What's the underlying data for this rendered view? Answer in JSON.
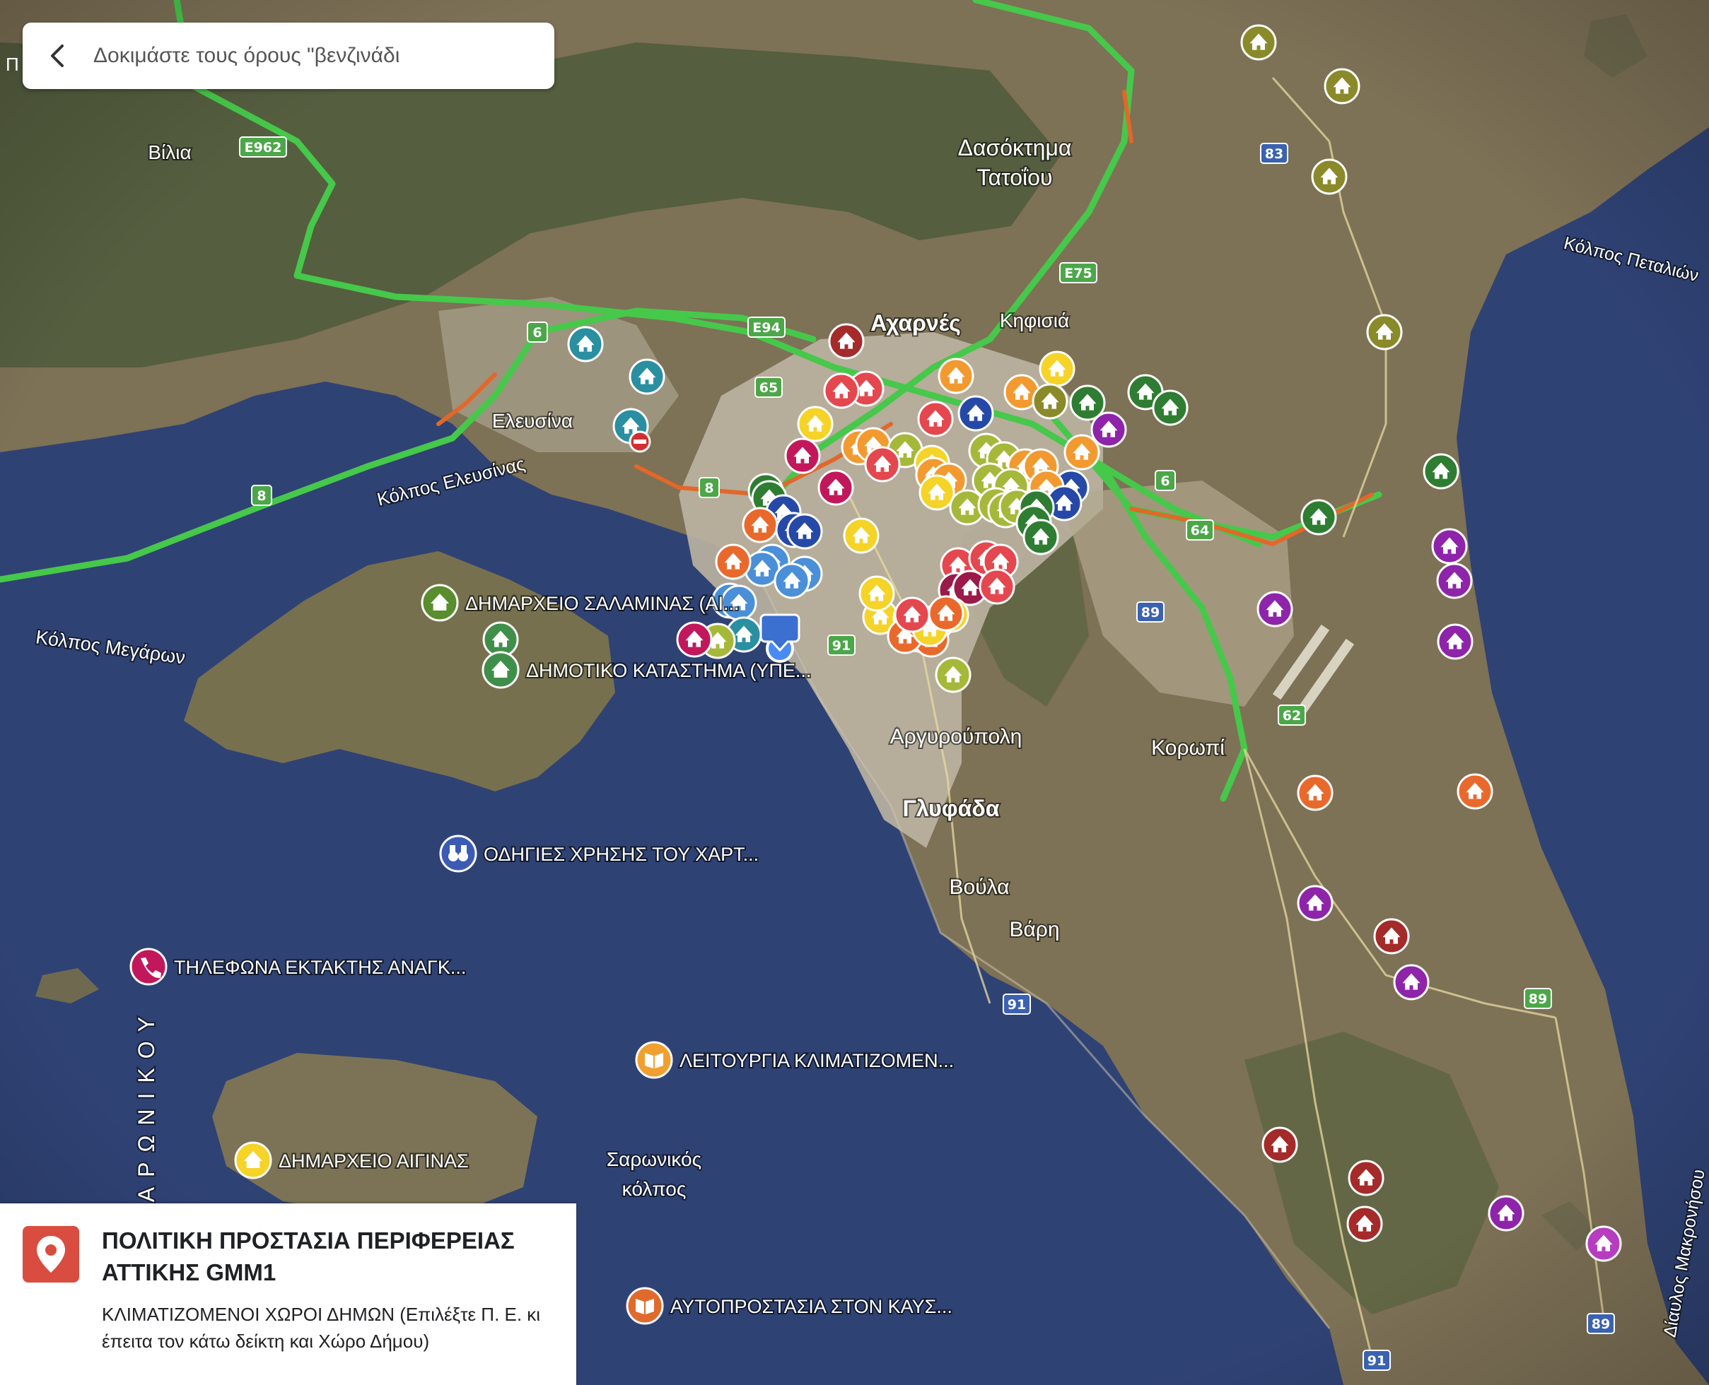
{
  "search": {
    "placeholder": "Δοκιμάστε τους όρους \"βενζινάδι",
    "edge_glyph": "Π"
  },
  "info_card": {
    "title": "ΠΟΛΙΤΙΚΗ ΠΡΟΣΤΑΣΙΑ ΠΕΡΙΦΕΡΕΙΑΣ ΑΤΤΙΚΗΣ GMM1",
    "subtitle": "ΚΛΙΜΑΤΙΖΟΜΕΝΟΙ ΧΩΡΟΙ ΔΗΜΩΝ (Επιλέξτε Π. Ε. κι έπειτα τον κάτω δείκτη και Χώρο Δήμου)",
    "pin_color": "#d84d3f"
  },
  "colors": {
    "sea": "#2d3f6e",
    "land": "#7a6e55",
    "mountain": "#4f5a3a",
    "urban": "#c8c0b0",
    "highway": "#46c84a",
    "traffic": "#e2672b"
  },
  "places": [
    {
      "text": "Βίλια",
      "style": "w"
    },
    {
      "text": "Δασόκτημα",
      "style": "w"
    },
    {
      "text": "Τατοΐου",
      "style": "w"
    },
    {
      "text": "Αχαρνές",
      "style": "b"
    },
    {
      "text": "Κηφισιά",
      "style": "w"
    },
    {
      "text": "Ελευσίνα",
      "style": "w"
    },
    {
      "text": "Κόλπος Ελευσίνας",
      "style": "w"
    },
    {
      "text": "Κόλπος Μεγάρων",
      "style": "w"
    },
    {
      "text": "Κόλπος Πεταλιών",
      "style": "w"
    },
    {
      "text": "Αργυρούπολη",
      "style": "w"
    },
    {
      "text": "Κορωπί",
      "style": "w"
    },
    {
      "text": "Γλυφάδα",
      "style": "b"
    },
    {
      "text": "Βούλα",
      "style": "w"
    },
    {
      "text": "Βάρη",
      "style": "w"
    },
    {
      "text": "Σαρωνικός",
      "style": "w"
    },
    {
      "text": "κόλπος",
      "style": "w"
    },
    {
      "text": "Δίαυλος Μακρονήσου",
      "style": "w"
    },
    {
      "text": "ΣΑΡΩΝΙΚΟΥ",
      "style": "v"
    }
  ],
  "road_shields": [
    "E962",
    "E75",
    "E94",
    "6",
    "65",
    "8",
    "8",
    "6",
    "64",
    "89",
    "91",
    "83",
    "62",
    "91",
    "89",
    "89",
    "91"
  ],
  "labeled_markers": [
    {
      "label": "ΔΗΜΑΡΧΕΙΟ ΣΑΛΑΜΙΝΑΣ (ΑΙ...",
      "icon": "house-icon",
      "color": "#5a8d2d"
    },
    {
      "label": "ΔΗΜΟΤΙΚΟ ΚΑΤΑΣΤΗΜΑ (ΥΠΕ...",
      "icon": "house-icon",
      "color": "#3f8f4a"
    },
    {
      "label": "ΟΔΗΓΙΕΣ ΧΡΗΣΗΣ ΤΟΥ ΧΑΡΤ...",
      "icon": "binoculars-icon",
      "color": "#3b5bb5"
    },
    {
      "label": "ΤΗΛΕΦΩΝΑ ΕΚΤΑΚΤΗΣ ΑΝΑΓΚ...",
      "icon": "phone-icon",
      "color": "#c2185b"
    },
    {
      "label": "ΛΕΙΤΟΥΡΓΙΑ ΚΛΙΜΑΤΙΖΟΜΕΝ...",
      "icon": "book-icon",
      "color": "#f0a030"
    },
    {
      "label": "ΔΗΜΑΡΧΕΙΟ ΑΙΓΙΝΑΣ",
      "icon": "house-icon",
      "color": "#f5d327"
    },
    {
      "label": "ΑΥΤΟΠΡΟΣΤΑΣΙΑ ΣΤΟΝ ΚΑΥΣ...",
      "icon": "book-icon",
      "color": "#e06a2c"
    }
  ],
  "marker_colors": {
    "y": "#f5d327",
    "o": "#f29a30",
    "O": "#e9692c",
    "r": "#e5474f",
    "R": "#a52a2a",
    "m": "#c2185b",
    "M": "#9a1a4a",
    "g": "#4caf50",
    "G": "#2e7d32",
    "l": "#a6b83a",
    "L": "#8a8a2a",
    "t": "#2a8fa0",
    "b": "#4a8fd8",
    "B": "#2649a8",
    "p": "#8e24aa",
    "P": "#b63cc0"
  }
}
